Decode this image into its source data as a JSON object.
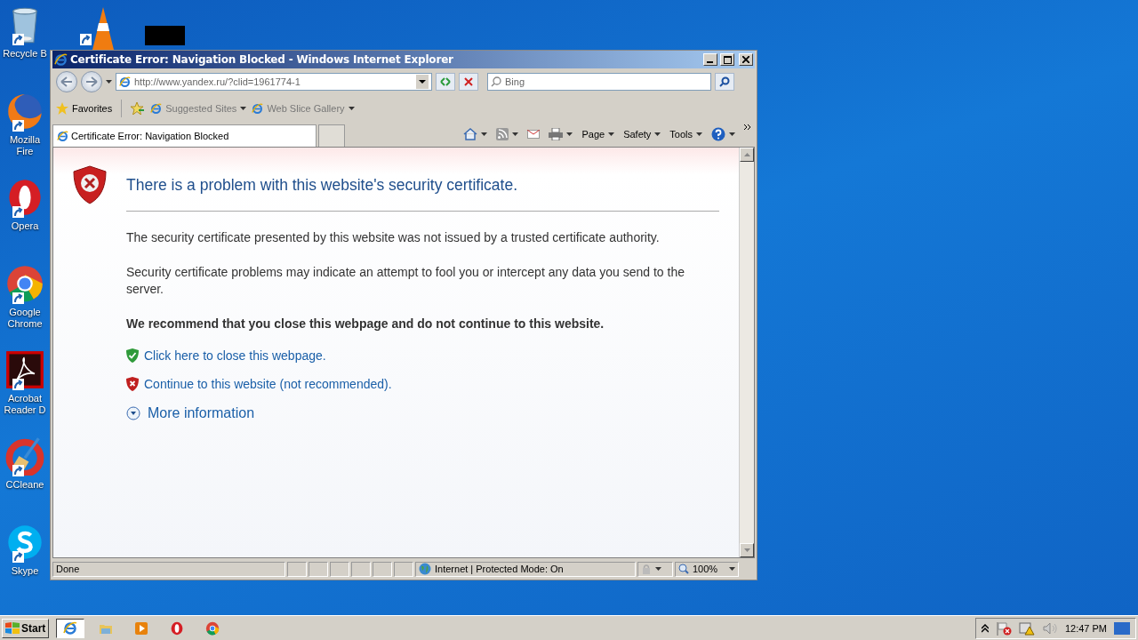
{
  "desktop_icons": [
    {
      "kind": "recycle",
      "label": "Recycle B"
    },
    {
      "kind": "firefox",
      "label": "Mozilla Fire"
    },
    {
      "kind": "opera",
      "label": "Opera"
    },
    {
      "kind": "chrome",
      "label": "Google Chrome"
    },
    {
      "kind": "acrobat",
      "label": "Acrobat Reader D"
    },
    {
      "kind": "ccleaner",
      "label": "CCleane"
    },
    {
      "kind": "skype",
      "label": "Skype"
    }
  ],
  "window": {
    "title": "Certificate Error: Navigation Blocked - Windows Internet Explorer",
    "address": "http://www.yandex.ru/?clid=1961774-1",
    "search": {
      "placeholder": "Bing"
    },
    "favorites": {
      "label": "Favorites",
      "links": [
        "Suggested Sites",
        "Web Slice Gallery"
      ]
    },
    "tabs": [
      {
        "label": "Certificate Error: Navigation Blocked",
        "selected": true
      }
    ],
    "commands": [
      "Page",
      "Safety",
      "Tools"
    ],
    "page": {
      "heading": "There is a problem with this website's security certificate.",
      "paragraphs": [
        "The security certificate presented by this website was not issued by a trusted certificate authority.",
        "Security certificate problems may indicate an attempt to fool you or intercept any data you send to the server."
      ],
      "recommendation": "We recommend that you close this webpage and do not continue to this website.",
      "links": [
        {
          "kind": "safe",
          "label": "Click here to close this webpage."
        },
        {
          "kind": "unsafe",
          "label": "Continue to this website (not recommended)."
        }
      ],
      "more_info": {
        "label": "More information",
        "expanded": false
      }
    },
    "status_bar": {
      "status": "Done",
      "zone": "Internet | Protected Mode: On",
      "zoom": "100%"
    }
  },
  "taskbar": {
    "start": "Start",
    "apps": [
      {
        "kind": "ie",
        "selected": true
      },
      {
        "kind": "folder",
        "selected": false
      },
      {
        "kind": "media",
        "selected": false
      },
      {
        "kind": "opera",
        "selected": false
      },
      {
        "kind": "chrome",
        "selected": false
      }
    ],
    "clock": "12:47 PM"
  }
}
